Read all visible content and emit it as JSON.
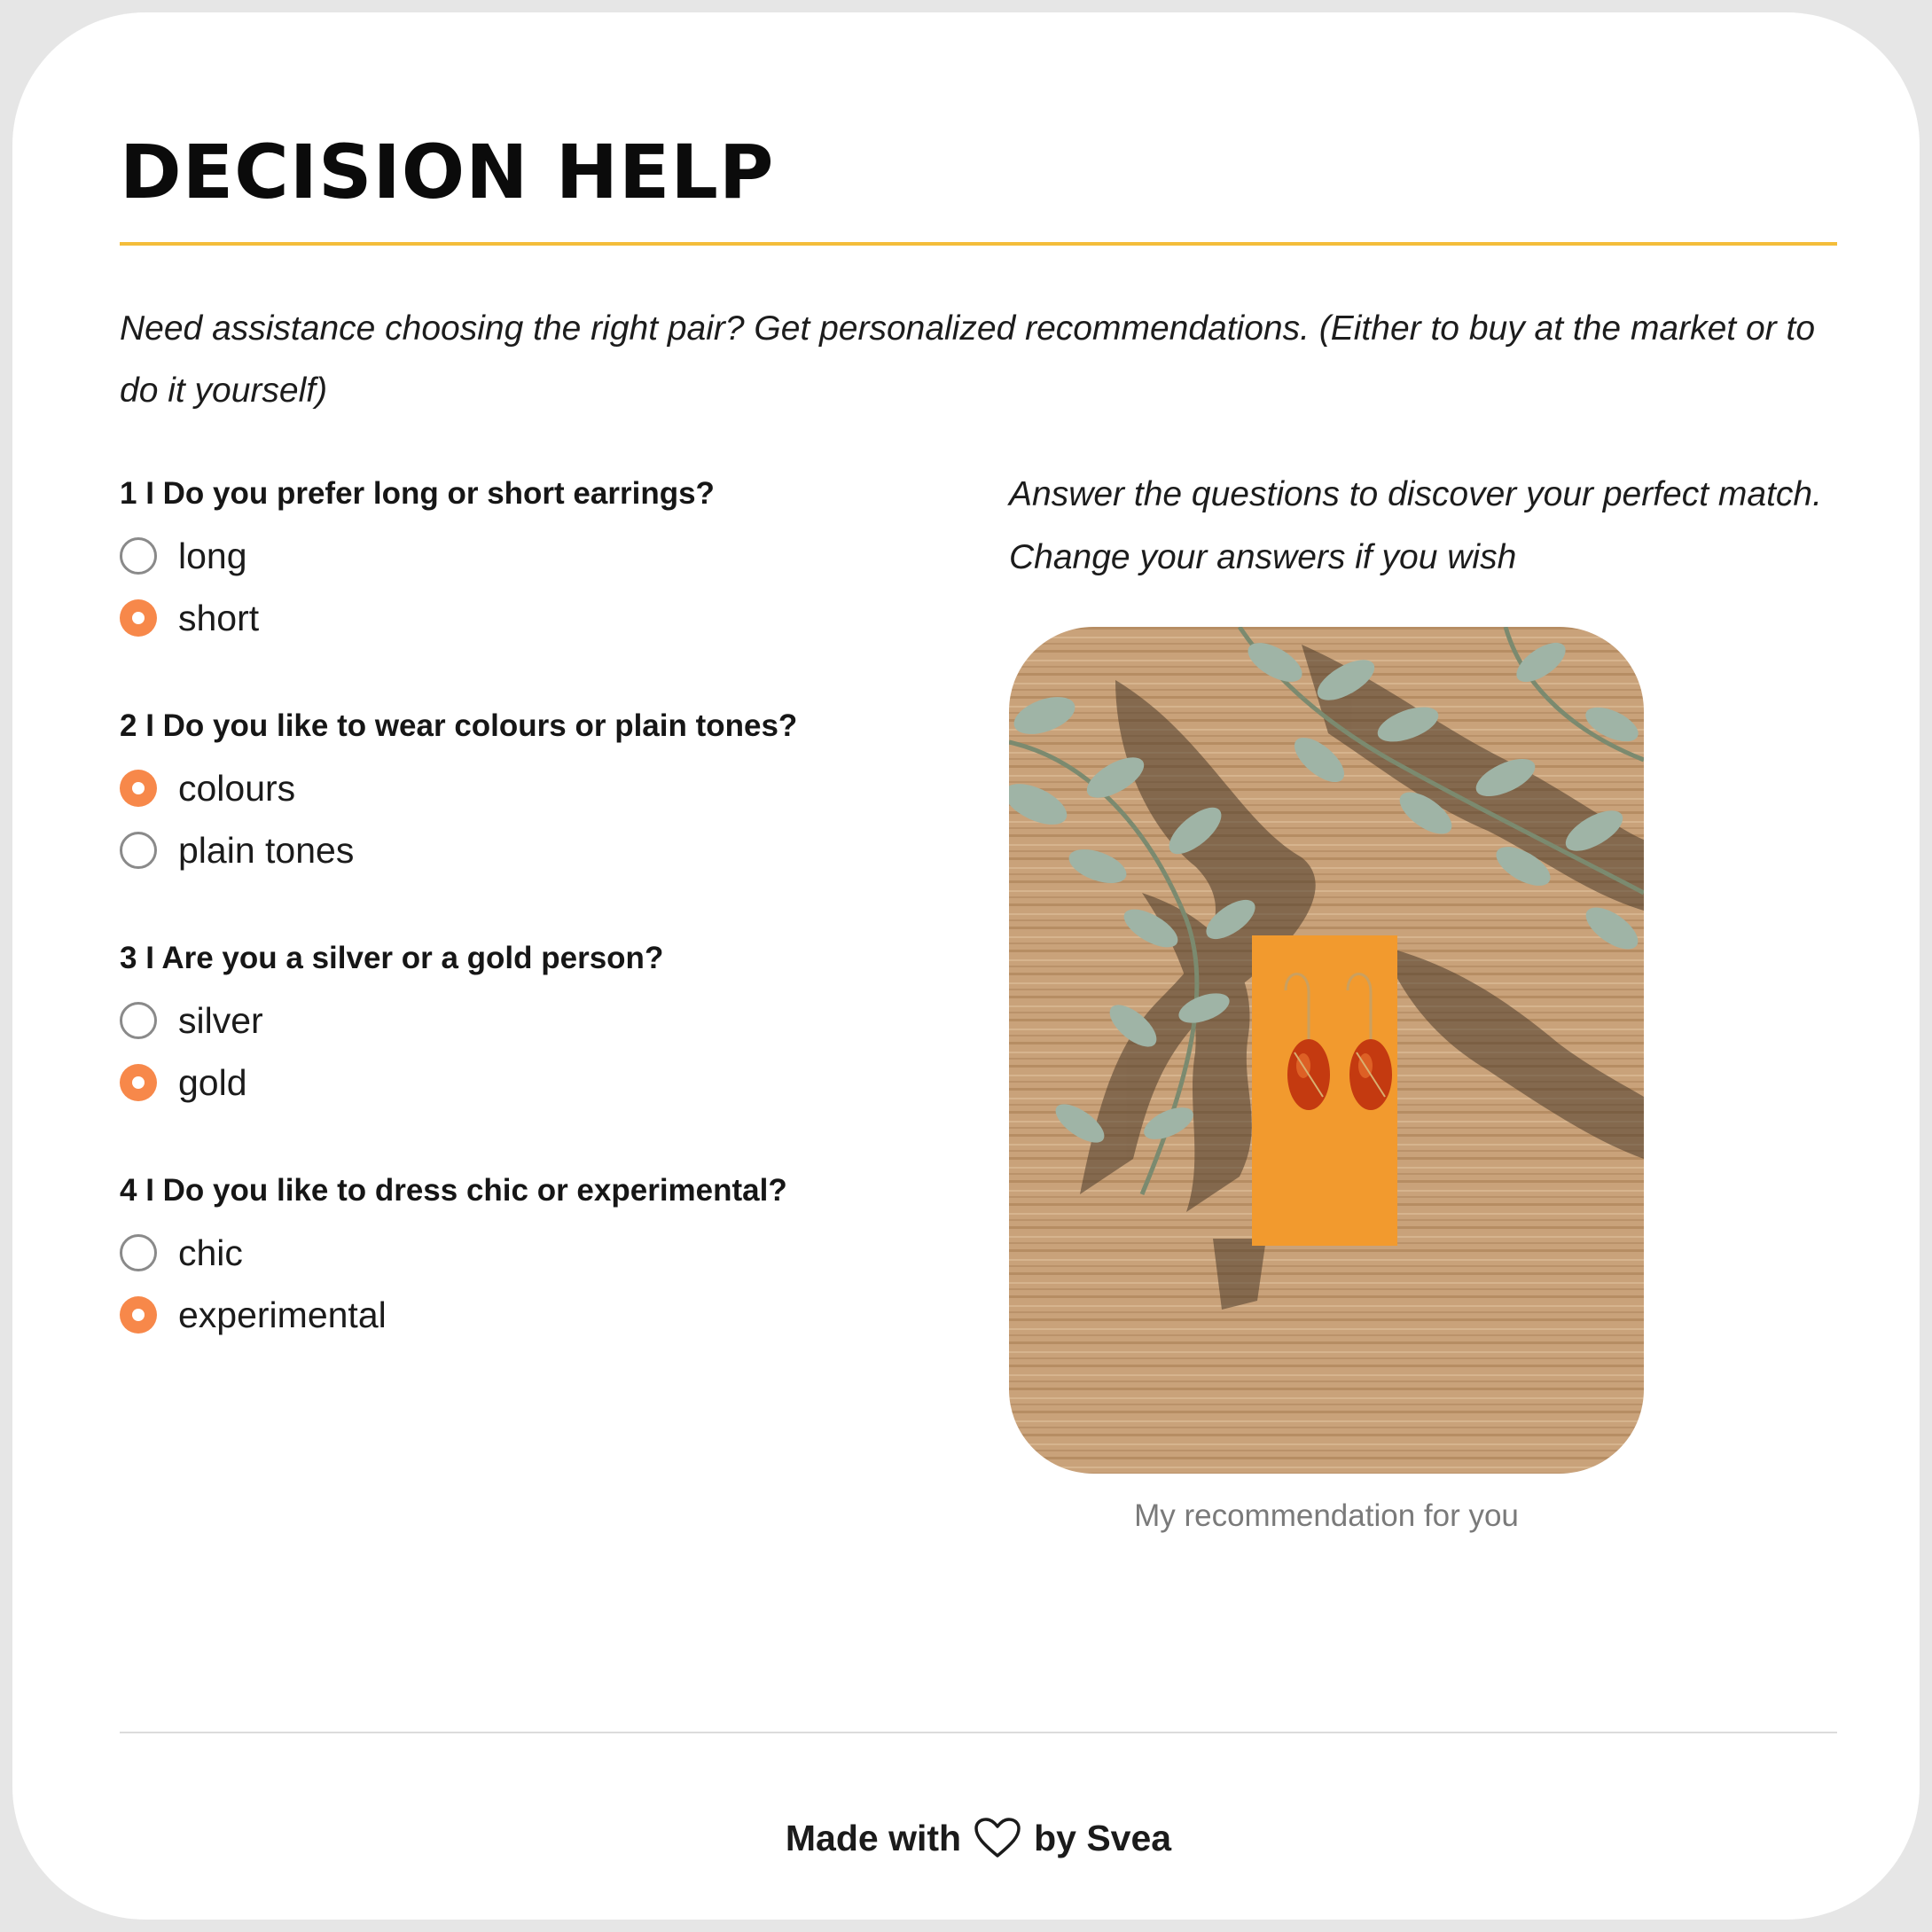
{
  "header": {
    "title": "DECISION HELP",
    "intro": "Need assistance choosing the right pair? Get personalized recommendations. (Either to buy at the market or to do it yourself)"
  },
  "questions": [
    {
      "label": "1 I Do you prefer long or short earrings?",
      "options": [
        {
          "label": "long",
          "selected": false
        },
        {
          "label": "short",
          "selected": true
        }
      ]
    },
    {
      "label": "2 I Do you like to wear colours or plain tones?",
      "options": [
        {
          "label": "colours",
          "selected": true
        },
        {
          "label": "plain tones",
          "selected": false
        }
      ]
    },
    {
      "label": "3 I Are you a silver or a gold person?",
      "options": [
        {
          "label": "silver",
          "selected": false
        },
        {
          "label": "gold",
          "selected": true
        }
      ]
    },
    {
      "label": "4 I Do you like to dress chic or experimental?",
      "options": [
        {
          "label": "chic",
          "selected": false
        },
        {
          "label": "experimental",
          "selected": true
        }
      ]
    }
  ],
  "result": {
    "intro": "Answer the questions to discover your perfect match. Change your answers if you wish",
    "caption": "My recommendation for you"
  },
  "footer": {
    "made_with": "Made with",
    "by": "by Svea"
  },
  "colors": {
    "accent_rule": "#f4bd3a",
    "radio_selected": "#f7884a"
  }
}
